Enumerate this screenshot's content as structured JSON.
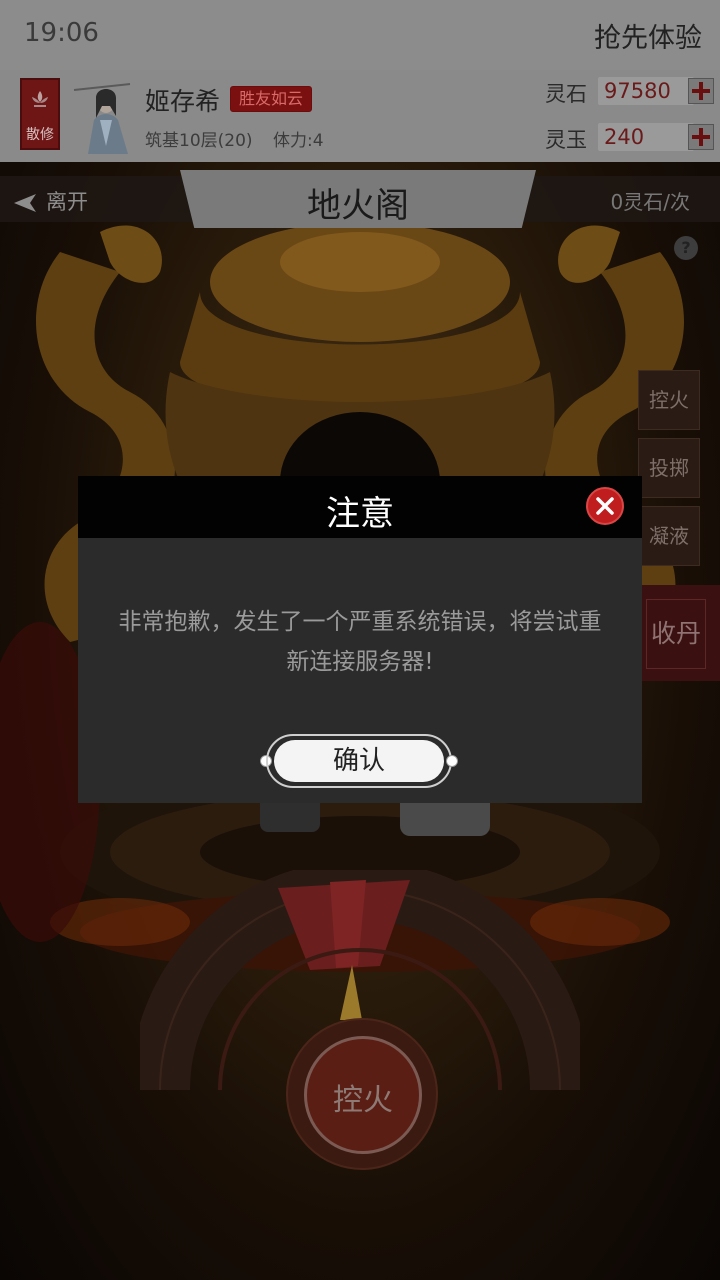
{
  "status_bar": {
    "time": "19:06",
    "cta": "抢先体验"
  },
  "player": {
    "badge": "散修",
    "name": "姬存希",
    "title": "胜友如云",
    "level": "筑基10层(20)",
    "stamina": "体力:4"
  },
  "resources": [
    {
      "label": "灵石",
      "value": "97580"
    },
    {
      "label": "灵玉",
      "value": "240"
    }
  ],
  "scene": {
    "leave": "离开",
    "title": "地火阁",
    "cost": "0灵石/次",
    "help": "?",
    "side_buttons": [
      "控火",
      "投掷",
      "凝液"
    ],
    "collect": "收丹",
    "fire_button": "控火"
  },
  "dialog": {
    "title": "注意",
    "message": "非常抱歉，发生了一个严重系统错误，将尝试重新连接服务器!",
    "confirm": "确认"
  },
  "colors": {
    "accent_red": "#c01e1e",
    "header_bg": "#8a8a8a",
    "dialog_bg": "#2b2b2b"
  }
}
